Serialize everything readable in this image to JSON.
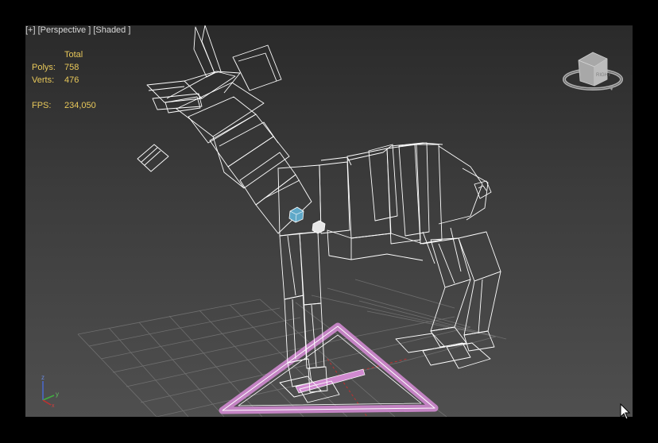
{
  "viewport": {
    "labels": {
      "plus": "[+]",
      "view": "[Perspective ]",
      "shading": "[Shaded ]"
    },
    "stats": {
      "header": "Total",
      "polys_label": "Polys:",
      "polys_value": "758",
      "verts_label": "Verts:",
      "verts_value": "476",
      "fps_label": "FPS:",
      "fps_value": "234,050"
    },
    "viewcube": {
      "face_label": "RIGHT"
    },
    "axis": {
      "z": "z",
      "y": "y",
      "x": "x"
    }
  },
  "colors": {
    "stats_text": "#e8c85a",
    "wireframe": "#ffffff",
    "grid": "#7a7a7a",
    "selection_pink": "#d08ad0",
    "axis_red": "#c03030"
  }
}
